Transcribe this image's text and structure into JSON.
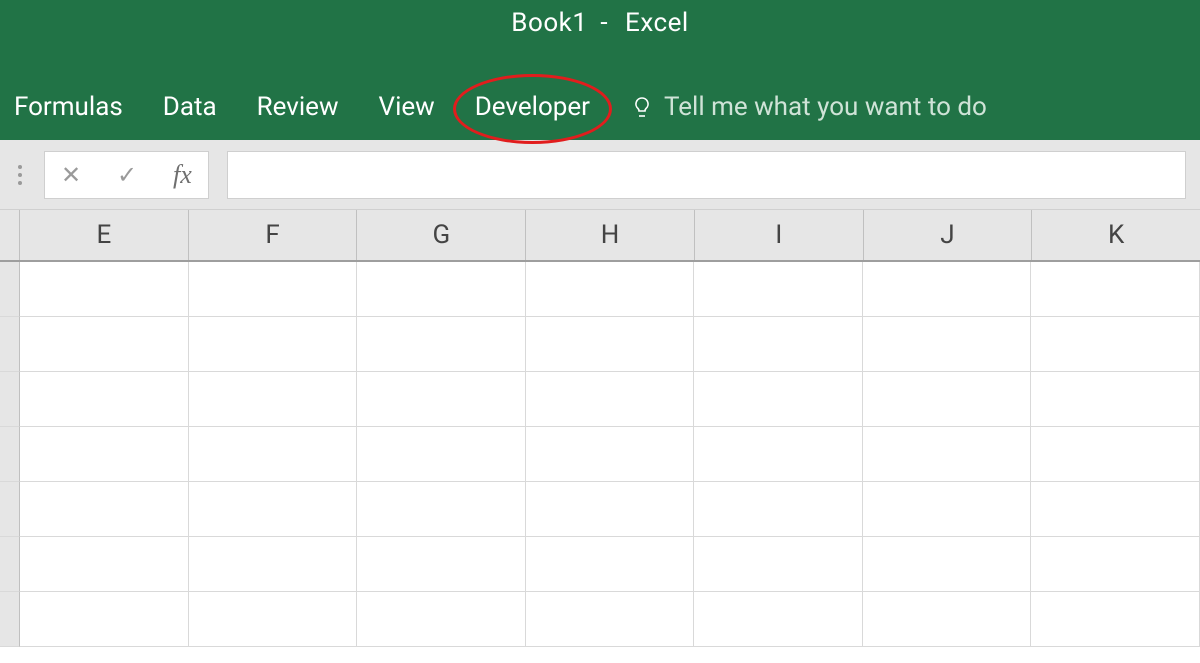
{
  "title": {
    "workbook": "Book1",
    "app": "Excel",
    "separator": "-"
  },
  "ribbon": {
    "tabs": [
      {
        "label": "Formulas"
      },
      {
        "label": "Data"
      },
      {
        "label": "Review"
      },
      {
        "label": "View"
      },
      {
        "label": "Developer",
        "annotated": true
      }
    ],
    "tell_me_placeholder": "Tell me what you want to do"
  },
  "formula_bar": {
    "fx_label": "fx",
    "value": ""
  },
  "grid": {
    "columns": [
      "E",
      "F",
      "G",
      "H",
      "I",
      "J",
      "K"
    ],
    "visible_rows": 7
  },
  "colors": {
    "brand": "#217346",
    "annotation": "#e11d1d"
  }
}
